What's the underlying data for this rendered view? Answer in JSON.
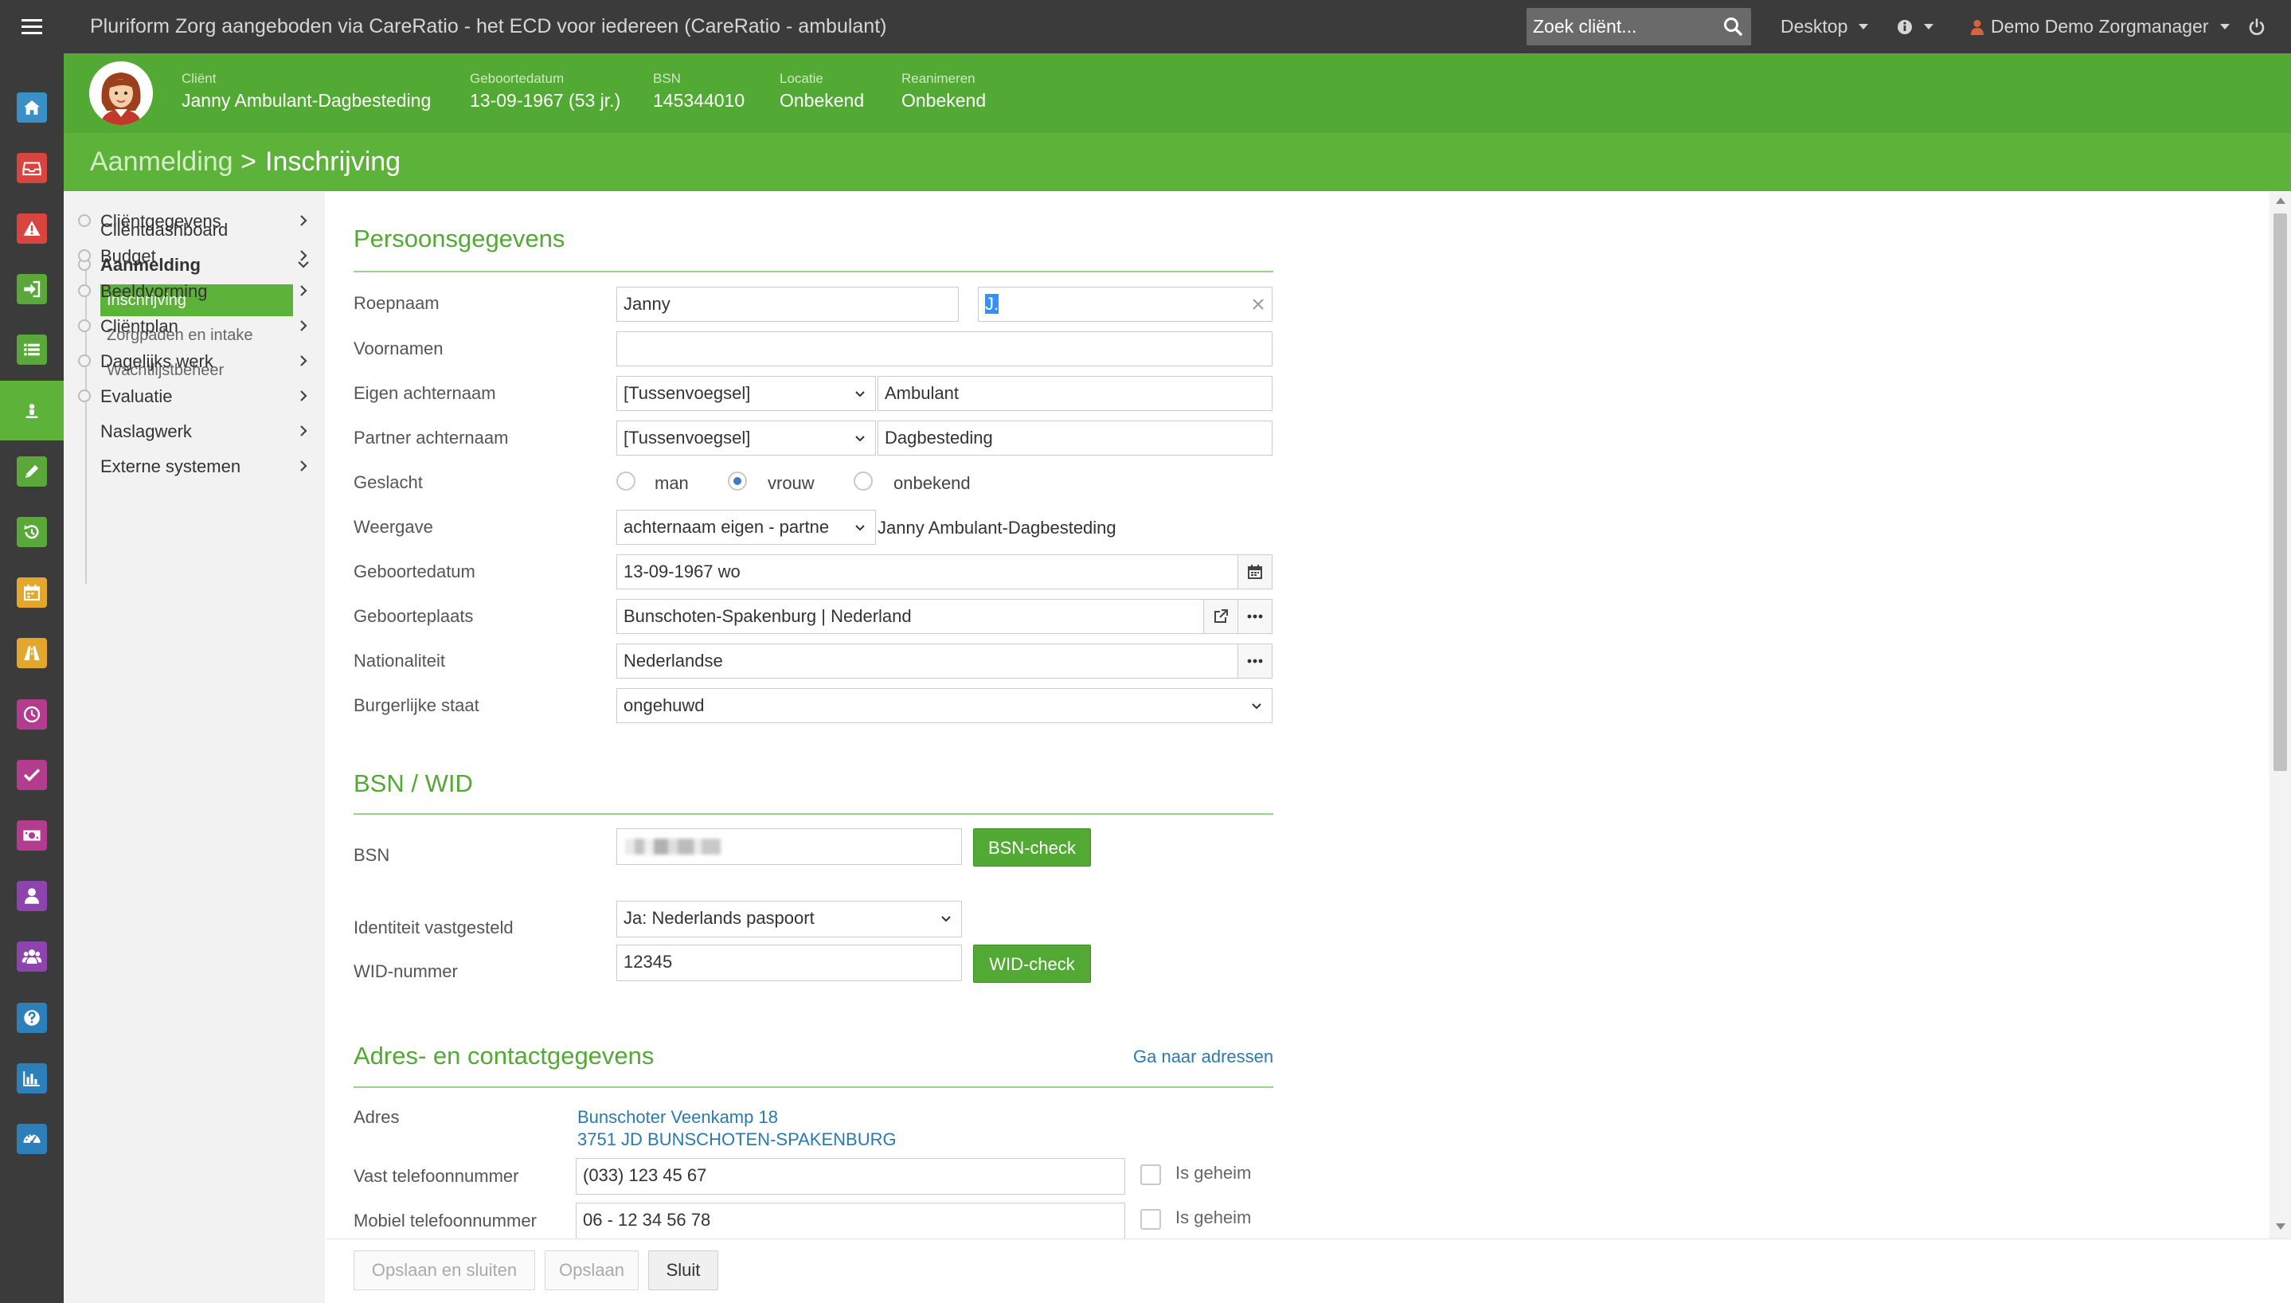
{
  "topbar": {
    "title": "Pluriform Zorg aangeboden via CareRatio - het ECD voor iedereen  (CareRatio - ambulant)",
    "search_placeholder": "Zoek cliënt...",
    "desktop_label": "Desktop",
    "user_label": "Demo Demo Zorgmanager"
  },
  "client": {
    "client_label": "Cliënt",
    "client_name": "Janny Ambulant-Dagbesteding",
    "dob_label": "Geboortedatum",
    "dob_value": "13-09-1967 (53 jr.)",
    "bsn_label": "BSN",
    "bsn_value": "145344010",
    "location_label": "Locatie",
    "location_value": "Onbekend",
    "resus_label": "Reanimeren",
    "resus_value": "Onbekend"
  },
  "breadcrumb": {
    "parent": "Aanmelding",
    "separator": ">",
    "current": "Inschrijving"
  },
  "sidebar": {
    "dashboard": "Cliëntdashboard",
    "aanmelding": "Aanmelding",
    "sub": [
      "Inschrijving",
      "Zorgpaden en intake",
      "Wachtlijstbeheer"
    ],
    "items": [
      "Cliëntgegevens",
      "Budget",
      "Beeldvorming",
      "Cliëntplan",
      "Dagelijks werk",
      "Evaluatie",
      "Naslagwerk",
      "Externe systemen"
    ]
  },
  "rail": {
    "icons": [
      "home-icon",
      "inbox-icon",
      "warning-icon",
      "sign-in-icon",
      "list-icon",
      "client-icon",
      "pencil-icon",
      "history-icon",
      "calendar-icon",
      "road-icon",
      "clock-icon",
      "check-icon",
      "money-icon",
      "user-icon",
      "group-icon",
      "help-icon",
      "bar-chart-icon",
      "dashboard-icon"
    ],
    "colors": [
      "#3a8fc7",
      "#d9443f",
      "#d9443f",
      "#5aa83a",
      "#5aa83a",
      "#5db33a",
      "#5aa83a",
      "#5aa83a",
      "#e3a82b",
      "#e3a82b",
      "#b33c8f",
      "#b33c8f",
      "#b33c8f",
      "#8e44ad",
      "#8e44ad",
      "#2c7fb8",
      "#2c7fb8",
      "#2c7fb8"
    ]
  },
  "persoonsgegevens": {
    "title": "Persoonsgegevens",
    "roepnaam_label": "Roepnaam",
    "roepnaam_value": "Janny",
    "initialen_value": "J.",
    "voornamen_label": "Voornamen",
    "voornamen_value": "",
    "eigen_label": "Eigen achternaam",
    "eigen_tussen": "[Tussenvoegsel]",
    "eigen_value": "Ambulant",
    "partner_label": "Partner achternaam",
    "partner_tussen": "[Tussenvoegsel]",
    "partner_value": "Dagbesteding",
    "geslacht_label": "Geslacht",
    "geslacht_options": [
      "man",
      "vrouw",
      "onbekend"
    ],
    "geslacht_selected": "vrouw",
    "weergave_label": "Weergave",
    "weergave_value": "achternaam eigen - partne",
    "weergave_result": "Janny Ambulant-Dagbesteding",
    "geboortedatum_label": "Geboortedatum",
    "geboortedatum_value": "13-09-1967 wo",
    "geboorteplaats_label": "Geboorteplaats",
    "geboorteplaats_value": "Bunschoten-Spakenburg | Nederland",
    "nationaliteit_label": "Nationaliteit",
    "nationaliteit_value": "Nederlandse",
    "burgerlijk_label": "Burgerlijke staat",
    "burgerlijk_value": "ongehuwd"
  },
  "bsn": {
    "title": "BSN / WID",
    "bsn_label": "BSN",
    "bsn_button": "BSN-check",
    "identiteit_label": "Identiteit vastgesteld",
    "identiteit_value": "Ja: Nederlands paspoort",
    "wid_label": "WID-nummer",
    "wid_value": "12345",
    "wid_button": "WID-check"
  },
  "adres": {
    "title": "Adres- en contactgegevens",
    "goto_link": "Ga naar adressen",
    "adres_label": "Adres",
    "adres_line1": "Bunschoter Veenkamp 18",
    "adres_line2": "3751 JD BUNSCHOTEN-SPAKENBURG",
    "vast_label": "Vast telefoonnummer",
    "vast_value": "(033) 123 45 67",
    "mobiel_label": "Mobiel telefoonnummer",
    "mobiel_value": "06 - 12 34 56 78",
    "geheim_label": "Is geheim"
  },
  "footer": {
    "save_close": "Opslaan en sluiten",
    "save": "Opslaan",
    "close": "Sluit"
  }
}
